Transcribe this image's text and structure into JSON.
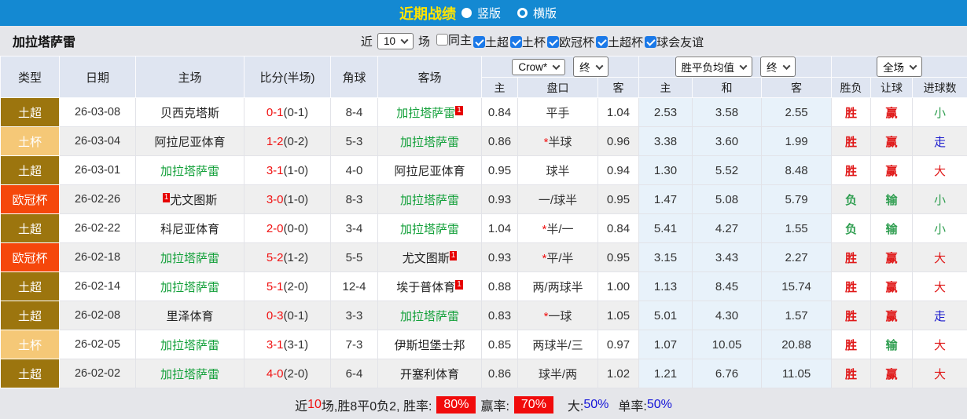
{
  "topbar": {
    "title": "近期战绩",
    "options": [
      {
        "label": "竖版",
        "selected": true
      },
      {
        "label": "横版",
        "selected": false
      }
    ]
  },
  "filterbar": {
    "team_name": "加拉塔萨雷",
    "near_label": "近",
    "matches_value": "10",
    "matches_label": "场",
    "checkboxes": [
      {
        "label": "同主",
        "checked": false
      },
      {
        "label": "土超",
        "checked": true
      },
      {
        "label": "土杯",
        "checked": true
      },
      {
        "label": "欧冠杯",
        "checked": true
      },
      {
        "label": "土超杯",
        "checked": true
      },
      {
        "label": "球会友谊",
        "checked": true
      }
    ]
  },
  "table": {
    "headers": {
      "type": "类型",
      "date": "日期",
      "home": "主场",
      "score": "比分(半场)",
      "corner": "角球",
      "away": "客场",
      "odds_company": "Crow*",
      "odds_final": "终",
      "odds_sub_home": "主",
      "odds_sub_handicap": "盘口",
      "odds_sub_away": "客",
      "avg_select": "胜平负均值",
      "avg_final": "终",
      "avg_sub_home": "主",
      "avg_sub_draw": "和",
      "avg_sub_away": "客",
      "scope_select": "全场",
      "result": "胜负",
      "handicap_result": "让球",
      "goals": "进球数"
    },
    "rows": [
      {
        "type": "土超",
        "type_key": "super",
        "date": "26-03-08",
        "home": "贝西克塔斯",
        "home_self": false,
        "home_badge_before": "",
        "home_badge_after": "",
        "ft": "0-1",
        "ht": "(0-1)",
        "corner": "8-4",
        "away": "加拉塔萨雷",
        "away_self": true,
        "away_badge_before": "",
        "away_badge_after": "1",
        "odds_home": "0.84",
        "handicap_star": "",
        "handicap": "平手",
        "odds_away": "1.04",
        "avg_home": "2.53",
        "avg_draw": "3.58",
        "avg_away": "2.55",
        "result": "胜",
        "result_key": "win",
        "handicap_result": "赢",
        "handicap_result_key": "win",
        "goals": "小",
        "goals_key": "small"
      },
      {
        "type": "土杯",
        "type_key": "cup",
        "date": "26-03-04",
        "home": "阿拉尼亚体育",
        "home_self": false,
        "home_badge_before": "",
        "home_badge_after": "",
        "ft": "1-2",
        "ht": "(0-2)",
        "corner": "5-3",
        "away": "加拉塔萨雷",
        "away_self": true,
        "away_badge_before": "",
        "away_badge_after": "",
        "odds_home": "0.86",
        "handicap_star": "*",
        "handicap": "半球",
        "odds_away": "0.96",
        "avg_home": "3.38",
        "avg_draw": "3.60",
        "avg_away": "1.99",
        "result": "胜",
        "result_key": "win",
        "handicap_result": "赢",
        "handicap_result_key": "win",
        "goals": "走",
        "goals_key": "draw"
      },
      {
        "type": "土超",
        "type_key": "super",
        "date": "26-03-01",
        "home": "加拉塔萨雷",
        "home_self": true,
        "home_badge_before": "",
        "home_badge_after": "",
        "ft": "3-1",
        "ht": "(1-0)",
        "corner": "4-0",
        "away": "阿拉尼亚体育",
        "away_self": false,
        "away_badge_before": "",
        "away_badge_after": "",
        "odds_home": "0.95",
        "handicap_star": "",
        "handicap": "球半",
        "odds_away": "0.94",
        "avg_home": "1.30",
        "avg_draw": "5.52",
        "avg_away": "8.48",
        "result": "胜",
        "result_key": "win",
        "handicap_result": "赢",
        "handicap_result_key": "win",
        "goals": "大",
        "goals_key": "big"
      },
      {
        "type": "欧冠杯",
        "type_key": "ucl",
        "date": "26-02-26",
        "home": "尤文图斯",
        "home_self": false,
        "home_badge_before": "1",
        "home_badge_after": "",
        "ft": "3-0",
        "ht": "(1-0)",
        "corner": "8-3",
        "away": "加拉塔萨雷",
        "away_self": true,
        "away_badge_before": "",
        "away_badge_after": "",
        "odds_home": "0.93",
        "handicap_star": "",
        "handicap": "一/球半",
        "odds_away": "0.95",
        "avg_home": "1.47",
        "avg_draw": "5.08",
        "avg_away": "5.79",
        "result": "负",
        "result_key": "lose",
        "handicap_result": "输",
        "handicap_result_key": "lose",
        "goals": "小",
        "goals_key": "small"
      },
      {
        "type": "土超",
        "type_key": "super",
        "date": "26-02-22",
        "home": "科尼亚体育",
        "home_self": false,
        "home_badge_before": "",
        "home_badge_after": "",
        "ft": "2-0",
        "ht": "(0-0)",
        "corner": "3-4",
        "away": "加拉塔萨雷",
        "away_self": true,
        "away_badge_before": "",
        "away_badge_after": "",
        "odds_home": "1.04",
        "handicap_star": "*",
        "handicap": "半/一",
        "odds_away": "0.84",
        "avg_home": "5.41",
        "avg_draw": "4.27",
        "avg_away": "1.55",
        "result": "负",
        "result_key": "lose",
        "handicap_result": "输",
        "handicap_result_key": "lose",
        "goals": "小",
        "goals_key": "small"
      },
      {
        "type": "欧冠杯",
        "type_key": "ucl",
        "date": "26-02-18",
        "home": "加拉塔萨雷",
        "home_self": true,
        "home_badge_before": "",
        "home_badge_after": "",
        "ft": "5-2",
        "ht": "(1-2)",
        "corner": "5-5",
        "away": "尤文图斯",
        "away_self": false,
        "away_badge_before": "",
        "away_badge_after": "1",
        "odds_home": "0.93",
        "handicap_star": "*",
        "handicap": "平/半",
        "odds_away": "0.95",
        "avg_home": "3.15",
        "avg_draw": "3.43",
        "avg_away": "2.27",
        "result": "胜",
        "result_key": "win",
        "handicap_result": "赢",
        "handicap_result_key": "win",
        "goals": "大",
        "goals_key": "big"
      },
      {
        "type": "土超",
        "type_key": "super",
        "date": "26-02-14",
        "home": "加拉塔萨雷",
        "home_self": true,
        "home_badge_before": "",
        "home_badge_after": "",
        "ft": "5-1",
        "ht": "(2-0)",
        "corner": "12-4",
        "away": "埃于普体育",
        "away_self": false,
        "away_badge_before": "",
        "away_badge_after": "1",
        "odds_home": "0.88",
        "handicap_star": "",
        "handicap": "两/两球半",
        "odds_away": "1.00",
        "avg_home": "1.13",
        "avg_draw": "8.45",
        "avg_away": "15.74",
        "result": "胜",
        "result_key": "win",
        "handicap_result": "赢",
        "handicap_result_key": "win",
        "goals": "大",
        "goals_key": "big"
      },
      {
        "type": "土超",
        "type_key": "super",
        "date": "26-02-08",
        "home": "里泽体育",
        "home_self": false,
        "home_badge_before": "",
        "home_badge_after": "",
        "ft": "0-3",
        "ht": "(0-1)",
        "corner": "3-3",
        "away": "加拉塔萨雷",
        "away_self": true,
        "away_badge_before": "",
        "away_badge_after": "",
        "odds_home": "0.83",
        "handicap_star": "*",
        "handicap": "一球",
        "odds_away": "1.05",
        "avg_home": "5.01",
        "avg_draw": "4.30",
        "avg_away": "1.57",
        "result": "胜",
        "result_key": "win",
        "handicap_result": "赢",
        "handicap_result_key": "win",
        "goals": "走",
        "goals_key": "draw"
      },
      {
        "type": "土杯",
        "type_key": "cup",
        "date": "26-02-05",
        "home": "加拉塔萨雷",
        "home_self": true,
        "home_badge_before": "",
        "home_badge_after": "",
        "ft": "3-1",
        "ht": "(3-1)",
        "corner": "7-3",
        "away": "伊斯坦堡士邦",
        "away_self": false,
        "away_badge_before": "",
        "away_badge_after": "",
        "odds_home": "0.85",
        "handicap_star": "",
        "handicap": "两球半/三",
        "odds_away": "0.97",
        "avg_home": "1.07",
        "avg_draw": "10.05",
        "avg_away": "20.88",
        "result": "胜",
        "result_key": "win",
        "handicap_result": "输",
        "handicap_result_key": "lose",
        "goals": "大",
        "goals_key": "big"
      },
      {
        "type": "土超",
        "type_key": "super",
        "date": "26-02-02",
        "home": "加拉塔萨雷",
        "home_self": true,
        "home_badge_before": "",
        "home_badge_after": "",
        "ft": "4-0",
        "ht": "(2-0)",
        "corner": "6-4",
        "away": "开塞利体育",
        "away_self": false,
        "away_badge_before": "",
        "away_badge_after": "",
        "odds_home": "0.86",
        "handicap_star": "",
        "handicap": "球半/两",
        "odds_away": "1.02",
        "avg_home": "1.21",
        "avg_draw": "6.76",
        "avg_away": "11.05",
        "result": "胜",
        "result_key": "win",
        "handicap_result": "赢",
        "handicap_result_key": "win",
        "goals": "大",
        "goals_key": "big"
      }
    ]
  },
  "footer": {
    "prefix": "近",
    "count": "10",
    "stats": "场,胜8平0负2, 胜率:",
    "win_rate": "80%",
    "odds_label": "赢率:",
    "odds_rate": "70%",
    "big_label": "大:",
    "big_rate": "50%",
    "single_label": "单率:",
    "single_rate": "50%"
  }
}
